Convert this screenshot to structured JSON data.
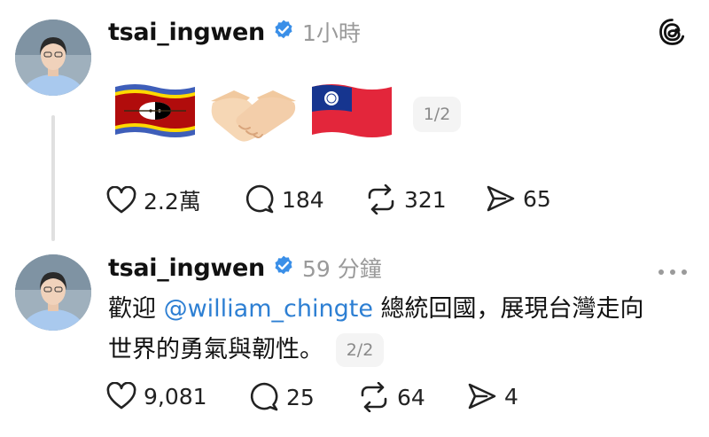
{
  "posts": [
    {
      "username": "tsai_ingwen",
      "timestamp": "1小時",
      "page": "1/2",
      "emojis": [
        "eswatini-flag",
        "handshake",
        "taiwan-flag"
      ],
      "actions": {
        "likes": "2.2萬",
        "replies": "184",
        "reposts": "321",
        "shares": "65"
      }
    },
    {
      "username": "tsai_ingwen",
      "timestamp": "59 分鐘",
      "page": "2/2",
      "text_before": "歡迎 ",
      "mention": "@william_chingte",
      "text_after_line1": " 總統回國，展現台灣走向",
      "text_line2": "世界的勇氣與韌性。",
      "actions": {
        "likes": "9,081",
        "replies": "25",
        "reposts": "64",
        "shares": "4"
      }
    }
  ],
  "icons": {
    "app": "threads-icon",
    "more": "more-options-icon"
  },
  "colors": {
    "verified": "#3a8fe8",
    "mention": "#2d7fd3",
    "muted": "#9a9a9a"
  }
}
